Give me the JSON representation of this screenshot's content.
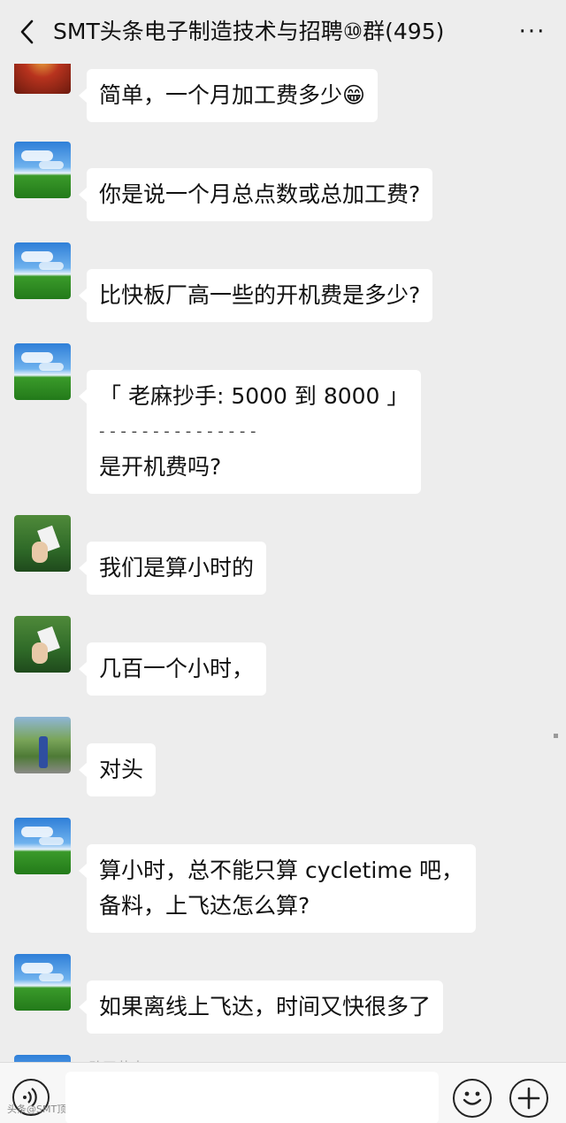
{
  "header": {
    "title": "SMT头条电子制造技术与招聘⑩群(495)",
    "more_label": "···"
  },
  "messages": [
    {
      "avatar": "red-pattern-avatar",
      "lines": [
        "简单，一个月加工费多少😁"
      ]
    },
    {
      "avatar": "xp-landscape-avatar",
      "lines": [
        "你是说一个月总点数或总加工费?"
      ]
    },
    {
      "avatar": "xp-landscape-avatar",
      "lines": [
        "比快板厂高一些的开机费是多少?"
      ]
    },
    {
      "avatar": "xp-landscape-avatar",
      "lines": [
        "「 老麻抄手: 5000 到 8000 」",
        "- - - - - - - - - - - - - - -",
        "是开机费吗?"
      ]
    },
    {
      "avatar": "green-jacket-avatar",
      "lines": [
        "我们是算小时的"
      ]
    },
    {
      "avatar": "green-jacket-avatar",
      "lines": [
        "几百一个小时，"
      ]
    },
    {
      "avatar": "park-person-avatar",
      "lines": [
        "对头"
      ]
    },
    {
      "avatar": "xp-landscape-avatar",
      "lines": [
        "算小时，总不能只算 cycletime 吧，",
        "备料，上飞达怎么算?"
      ]
    },
    {
      "avatar": "xp-landscape-avatar",
      "lines": [
        "如果离线上飞达，时间又快很多了"
      ]
    }
  ],
  "partial_sender_name": "敢天花中",
  "footer": {
    "voice_icon": "voice-icon",
    "emoji_icon": "emoji-icon",
    "plus_icon": "plus-icon",
    "watermark": "头条@SMT顶尖"
  }
}
